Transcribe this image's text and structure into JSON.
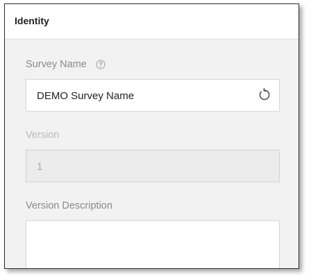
{
  "header": {
    "title": "Identity"
  },
  "survey_name": {
    "label": "Survey Name",
    "help_icon": "help-circle-icon",
    "value": "DEMO Survey Name",
    "reset_icon": "reset-icon"
  },
  "version": {
    "label": "Version",
    "value": "1"
  },
  "version_description": {
    "label": "Version Description",
    "value": ""
  }
}
